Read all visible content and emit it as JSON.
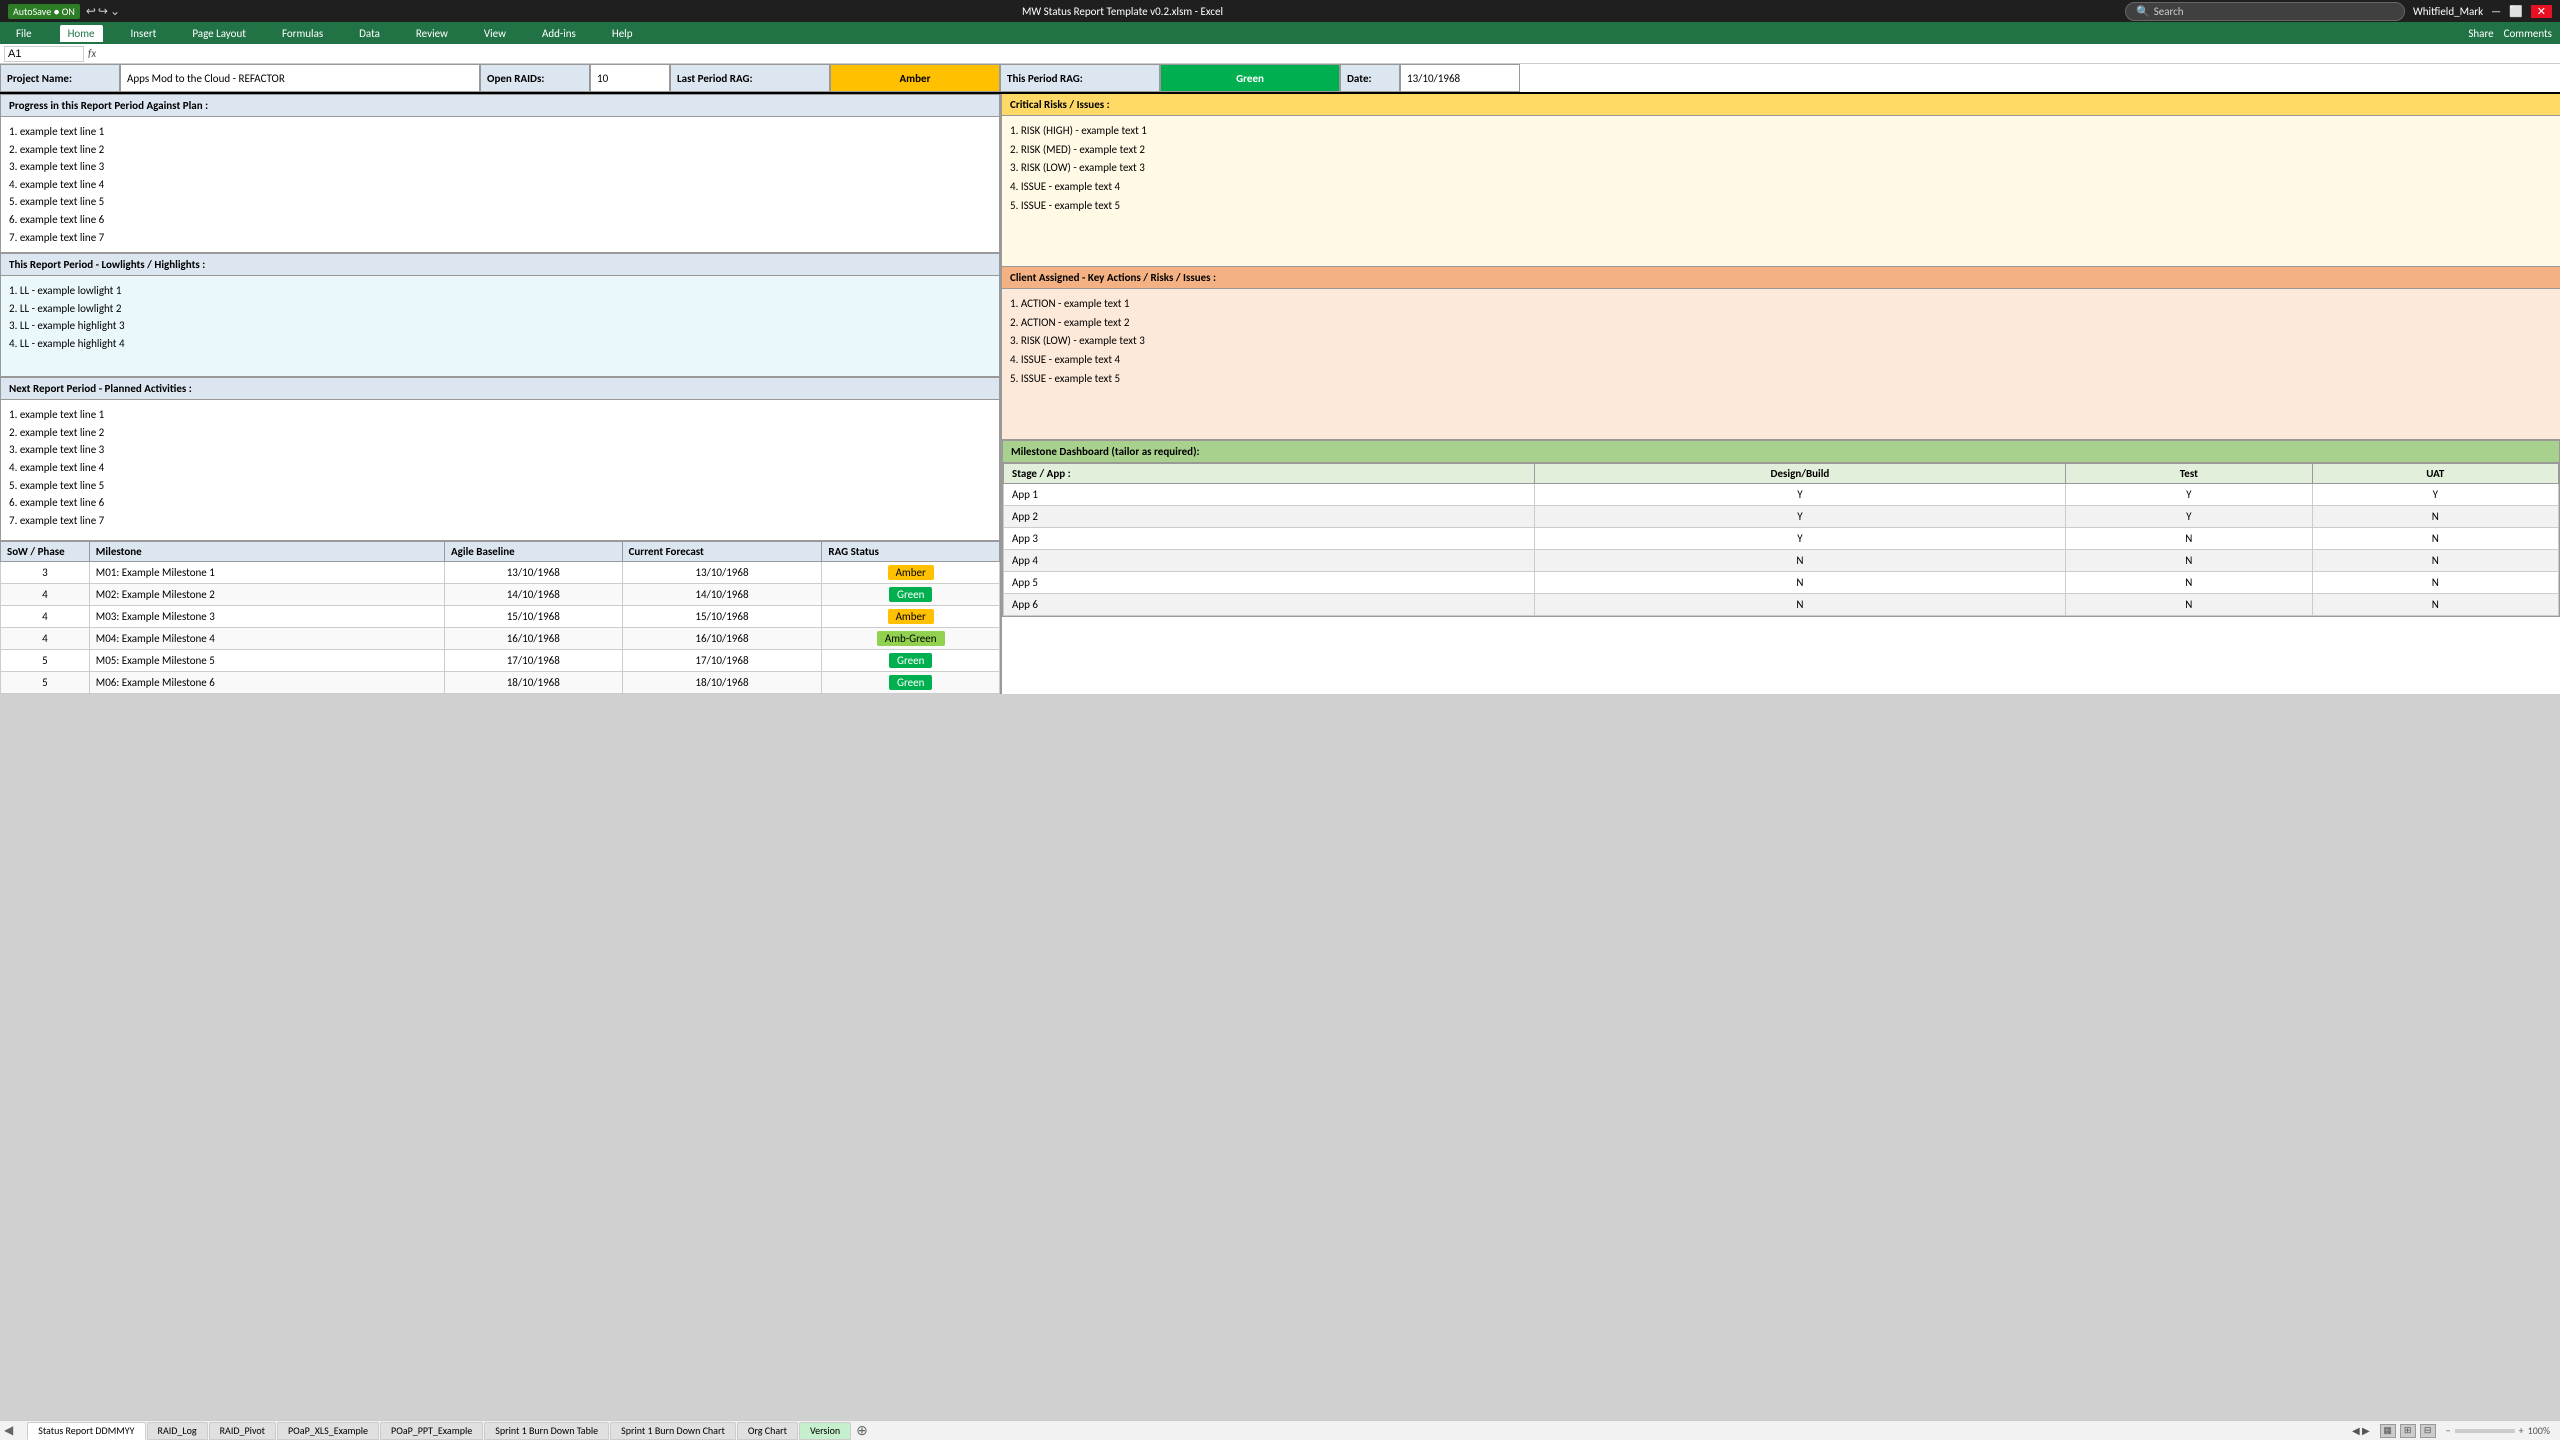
{
  "titleBar": {
    "appName": "AutoSave",
    "autoSaveOn": "ON",
    "fileName": "MW Status Report Template v0.2.xlsm - Excel",
    "userName": "Whitfield_Mark",
    "undoLabel": "↩",
    "redoLabel": "↪",
    "searchPlaceholder": "Search"
  },
  "ribbon": {
    "tabs": [
      "File",
      "Home",
      "Insert",
      "Page Layout",
      "Formulas",
      "Data",
      "Review",
      "View",
      "Add-ins",
      "Help"
    ],
    "activeTab": "Home",
    "shareLabel": "Share",
    "commentsLabel": "Comments"
  },
  "header": {
    "projectNameLabel": "Project Name:",
    "projectNameValue": "Apps Mod to the Cloud - REFACTOR",
    "openRaidsLabel": "Open RAIDs:",
    "openRaidsValue": "10",
    "lastPeriodRagLabel": "Last Period RAG:",
    "lastPeriodRagValue": "Amber",
    "thisPeriodRagLabel": "This Period RAG:",
    "thisPeriodRagValue": "Green",
    "dateLabel": "Date:",
    "dateValue": "13/10/1968"
  },
  "progressSection": {
    "title": "Progress in this Report Period Against Plan :",
    "items": [
      "1. example text line 1",
      "2. example text line 2",
      "3. example text line 3",
      "4. example text line 4",
      "5. example text line 5",
      "6. example text line 6",
      "7. example text line 7"
    ]
  },
  "lowlightsSection": {
    "title": "This Report Period - Lowlights / Highlights :",
    "items": [
      "1. LL - example lowlight 1",
      "2. LL - example lowlight 2",
      "3. LL - example highlight 3",
      "4. LL - example highlight 4"
    ]
  },
  "nextPeriodSection": {
    "title": "Next Report Period - Planned Activities :",
    "items": [
      "1. example text line 1",
      "2. example text line 2",
      "3. example text line 3",
      "4. example text line 4",
      "5. example text line 5",
      "6. example text line 6",
      "7. example text line 7"
    ]
  },
  "criticalRisksSection": {
    "title": "Critical Risks / Issues :",
    "items": [
      "1. RISK (HIGH) - example text 1",
      "2. RISK (MED) - example text 2",
      "3. RISK (LOW) - example text 3",
      "4. ISSUE - example text 4",
      "5. ISSUE - example text 5"
    ]
  },
  "clientActionsSection": {
    "title": "Client Assigned - Key Actions / Risks / Issues :",
    "items": [
      "1. ACTION - example text 1",
      "2. ACTION - example text 2",
      "3. RISK (LOW) - example text 3",
      "4. ISSUE - example text 4",
      "5. ISSUE - example text 5"
    ]
  },
  "milestonesTable": {
    "headers": [
      "SoW / Phase",
      "Milestone",
      "Agile Baseline",
      "Current Forecast",
      "RAG Status"
    ],
    "rows": [
      {
        "phase": "3",
        "milestone": "M01: Example Milestone 1",
        "baseline": "13/10/1968",
        "forecast": "13/10/1968",
        "rag": "Amber",
        "ragClass": "badge-amber"
      },
      {
        "phase": "4",
        "milestone": "M02: Example Milestone 2",
        "baseline": "14/10/1968",
        "forecast": "14/10/1968",
        "rag": "Green",
        "ragClass": "badge-green"
      },
      {
        "phase": "4",
        "milestone": "M03: Example Milestone 3",
        "baseline": "15/10/1968",
        "forecast": "15/10/1968",
        "rag": "Amber",
        "ragClass": "badge-amber"
      },
      {
        "phase": "4",
        "milestone": "M04: Example Milestone 4",
        "baseline": "16/10/1968",
        "forecast": "16/10/1968",
        "rag": "Amb-Green",
        "ragClass": "badge-amb-green"
      },
      {
        "phase": "5",
        "milestone": "M05: Example Milestone 5",
        "baseline": "17/10/1968",
        "forecast": "17/10/1968",
        "rag": "Green",
        "ragClass": "badge-green"
      },
      {
        "phase": "5",
        "milestone": "M06: Example Milestone 6",
        "baseline": "18/10/1968",
        "forecast": "18/10/1968",
        "rag": "Green",
        "ragClass": "badge-green"
      }
    ]
  },
  "milestoneDashboard": {
    "title": "Milestone Dashboard (tailor as required):",
    "headers": [
      "Stage / App :",
      "Design/Build",
      "Test",
      "UAT"
    ],
    "rows": [
      {
        "app": "App 1",
        "designBuild": "Y",
        "test": "Y",
        "uat": "Y",
        "even": false
      },
      {
        "app": "App 2",
        "designBuild": "Y",
        "test": "Y",
        "uat": "N",
        "even": true
      },
      {
        "app": "App 3",
        "designBuild": "Y",
        "test": "N",
        "uat": "N",
        "even": false
      },
      {
        "app": "App 4",
        "designBuild": "N",
        "test": "N",
        "uat": "N",
        "even": true
      },
      {
        "app": "App 5",
        "designBuild": "N",
        "test": "N",
        "uat": "N",
        "even": false
      },
      {
        "app": "App 6",
        "designBuild": "N",
        "test": "N",
        "uat": "N",
        "even": true
      }
    ]
  },
  "sheetTabs": [
    {
      "label": "Status Report DDMMYY",
      "active": true,
      "color": "normal"
    },
    {
      "label": "RAID_Log",
      "active": false,
      "color": "normal"
    },
    {
      "label": "RAID_Pivot",
      "active": false,
      "color": "normal"
    },
    {
      "label": "POaP_XLS_Example",
      "active": false,
      "color": "normal"
    },
    {
      "label": "POaP_PPT_Example",
      "active": false,
      "color": "normal"
    },
    {
      "label": "Sprint 1 Burn Down Table",
      "active": false,
      "color": "normal"
    },
    {
      "label": "Sprint 1 Burn Down Chart",
      "active": false,
      "color": "normal"
    },
    {
      "label": "Org Chart",
      "active": false,
      "color": "normal"
    },
    {
      "label": "Version",
      "active": false,
      "color": "green"
    }
  ],
  "statusBar": {
    "zoomLevel": "100%",
    "viewNormal": "▦",
    "viewPage": "⊞",
    "viewPreview": "⊟"
  }
}
